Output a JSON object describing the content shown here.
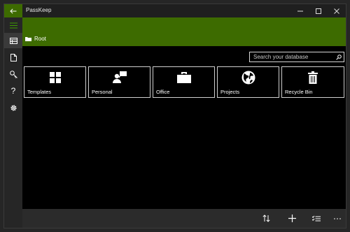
{
  "app": {
    "title": "PassKeep"
  },
  "breadcrumb": {
    "root_label": "Root"
  },
  "search": {
    "placeholder": "Search your database"
  },
  "tiles": [
    {
      "label": "Templates",
      "icon": "grid-icon"
    },
    {
      "label": "Personal",
      "icon": "person-chat-icon"
    },
    {
      "label": "Office",
      "icon": "briefcase-icon"
    },
    {
      "label": "Projects",
      "icon": "globe-icon"
    },
    {
      "label": "Recycle Bin",
      "icon": "trash-icon"
    }
  ],
  "rail": [
    "hamburger-menu-icon",
    "database-icon",
    "new-file-icon",
    "key-icon",
    "help-icon",
    "settings-icon"
  ],
  "commands": [
    "sort-icon",
    "add-icon",
    "select-list-icon",
    "more-icon"
  ],
  "colors": {
    "accent": "#3d6b00",
    "background": "#000000",
    "chrome": "#262626"
  }
}
